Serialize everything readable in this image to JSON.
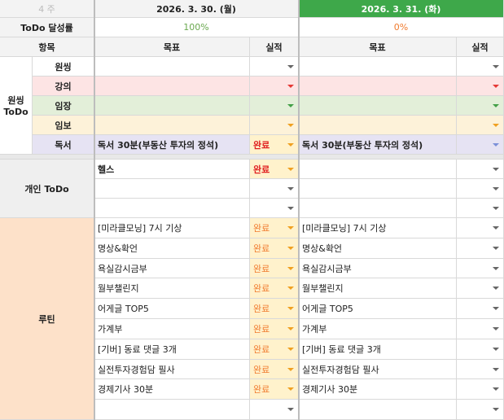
{
  "header": {
    "week_label": "4 주",
    "day1": "2026. 3. 30. (월)",
    "day2": "2026. 3. 31. (화)",
    "todo_rate_label": "ToDo 달성률",
    "rate1": "100%",
    "rate2": "0%",
    "item_label": "항목",
    "goal_label": "목표",
    "result_label": "실적"
  },
  "wonsing": {
    "group_label": "원씽 ToDo",
    "rows": [
      {
        "label": "원씽",
        "color": "#ffffff",
        "arrow": "#666666",
        "goal1": "",
        "res1": "",
        "goal2": "",
        "arrow2": "#666666"
      },
      {
        "label": "강의",
        "color": "#fde4e4",
        "arrow": "#e53935",
        "goal1": "",
        "res1": "",
        "goal2": "",
        "arrow2": "#e53935"
      },
      {
        "label": "임장",
        "color": "#e3efd9",
        "arrow": "#43a047",
        "goal1": "",
        "res1": "",
        "goal2": "",
        "arrow2": "#43a047"
      },
      {
        "label": "임보",
        "color": "#fdf2d9",
        "arrow": "#f0a020",
        "goal1": "",
        "res1": "",
        "goal2": "",
        "arrow2": "#f0a020"
      },
      {
        "label": "독서",
        "color": "#e6e3f3",
        "arrow": "#7b68c8",
        "goal1": "독서 30분(부동산 투자의 정석)",
        "res1": "완료",
        "goal2": "독서 30분(부동산 투자의 정석)",
        "arrow2": "#7b8fd8"
      }
    ]
  },
  "personal": {
    "label": "개인 ToDo",
    "rows": [
      {
        "goal1": "헬스",
        "res1": "완료",
        "goal2": ""
      },
      {
        "goal1": "",
        "res1": "",
        "goal2": ""
      },
      {
        "goal1": "",
        "res1": "",
        "goal2": ""
      }
    ]
  },
  "routine": {
    "label": "루틴",
    "rows": [
      {
        "goal1": "[미라클모닝] 7시 기상",
        "res1": "완료",
        "goal2": "[미라클모닝] 7시 기상"
      },
      {
        "goal1": "명상&확언",
        "res1": "완료",
        "goal2": "명상&확언"
      },
      {
        "goal1": "욕실감시금부",
        "res1": "완료",
        "goal2": "욕실감시금부"
      },
      {
        "goal1": "월부챌린지",
        "res1": "완료",
        "goal2": "월부챌린지"
      },
      {
        "goal1": "어게글 TOP5",
        "res1": "완료",
        "goal2": "어게글 TOP5"
      },
      {
        "goal1": "가계부",
        "res1": "완료",
        "goal2": "가계부"
      },
      {
        "goal1": "[기버] 동료 댓글 3개",
        "res1": "완료",
        "goal2": "[기버] 동료 댓글 3개"
      },
      {
        "goal1": "실전투자경험담 필사",
        "res1": "완료",
        "goal2": "실전투자경험담 필사"
      },
      {
        "goal1": "경제기사 30분",
        "res1": "완료",
        "goal2": "경제기사 30분"
      },
      {
        "goal1": "",
        "res1": "",
        "goal2": ""
      }
    ]
  },
  "colors": {
    "header_gray": "#f3f3f3",
    "day2_green": "#3ea84a",
    "personal_bg": "#efefef",
    "routine_bg": "#fde1c9",
    "done_bg": "#fff2cc",
    "done_arrow": "#f0a020"
  }
}
